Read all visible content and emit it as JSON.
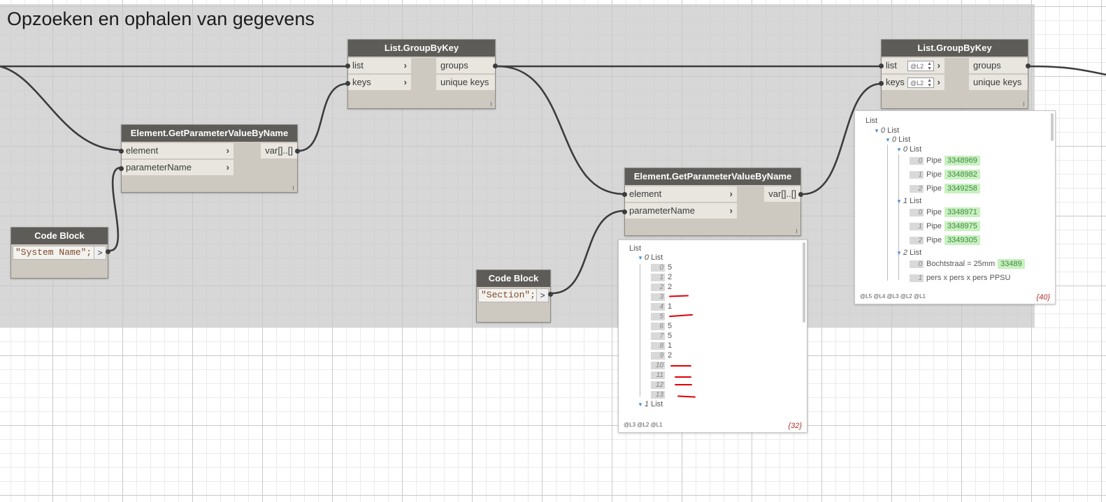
{
  "group": {
    "title": "Opzoeken en ophalen van gegevens"
  },
  "nodes": {
    "groupbykey1": {
      "title": "List.GroupByKey",
      "in": [
        "list",
        "keys"
      ],
      "out": [
        "groups",
        "unique keys"
      ]
    },
    "getparam1": {
      "title": "Element.GetParameterValueByName",
      "in": [
        "element",
        "parameterName"
      ],
      "out": "var[]..[]"
    },
    "codeblock1": {
      "title": "Code Block",
      "code": "\"System Name\";",
      "out": ">"
    },
    "groupbykey2": {
      "title": "List.GroupByKey",
      "in": [
        "list",
        "keys"
      ],
      "out": [
        "groups",
        "unique keys"
      ],
      "lacing": "@L2"
    },
    "getparam2": {
      "title": "Element.GetParameterValueByName",
      "in": [
        "element",
        "parameterName"
      ],
      "out": "var[]..[]"
    },
    "codeblock2": {
      "title": "Code Block",
      "code": "\"Section\";",
      "out": ">"
    }
  },
  "preview1": {
    "root": "List",
    "sub0": "0",
    "sub_label": "List",
    "items": [
      {
        "i": "0",
        "v": "5"
      },
      {
        "i": "1",
        "v": "2"
      },
      {
        "i": "2",
        "v": "2"
      },
      {
        "i": "3",
        "v": ""
      },
      {
        "i": "4",
        "v": "1"
      },
      {
        "i": "5",
        "v": ""
      },
      {
        "i": "6",
        "v": "5"
      },
      {
        "i": "7",
        "v": "5"
      },
      {
        "i": "8",
        "v": "1"
      },
      {
        "i": "9",
        "v": "2"
      },
      {
        "i": "10",
        "v": ""
      },
      {
        "i": "11",
        "v": ""
      },
      {
        "i": "12",
        "v": ""
      },
      {
        "i": "13",
        "v": ""
      }
    ],
    "sub1": "1",
    "levels": "@L3 @L2 @L1",
    "count": "{32}"
  },
  "preview2": {
    "root": "List",
    "l0": "0",
    "l00": "0",
    "l000": "0",
    "l1": "1",
    "l2": "2",
    "list_label": "List",
    "group0": [
      {
        "i": "0",
        "t": "Pipe",
        "v": "3348969"
      },
      {
        "i": "1",
        "t": "Pipe",
        "v": "3348982"
      },
      {
        "i": "2",
        "t": "Pipe",
        "v": "3349258"
      }
    ],
    "group1": [
      {
        "i": "0",
        "t": "Pipe",
        "v": "3348971"
      },
      {
        "i": "1",
        "t": "Pipe",
        "v": "3348975"
      },
      {
        "i": "2",
        "t": "Pipe",
        "v": "3349305"
      }
    ],
    "group2": [
      {
        "i": "0",
        "t": "Bochtstraal = 25mm",
        "v": "33489"
      },
      {
        "i": "1",
        "t": "pers x pers x pers PPSU",
        "v": ""
      }
    ],
    "levels": "@L5 @L4 @L3 @L2 @L1",
    "count": "{40}"
  },
  "colors": {
    "node_header": "#5e5c59",
    "node_body": "#cdc8c0",
    "group_bg": "#c8c8c8",
    "wire": "#3c3c3c",
    "preview_value": "#c8f0c0",
    "red_mark": "#e00000"
  }
}
